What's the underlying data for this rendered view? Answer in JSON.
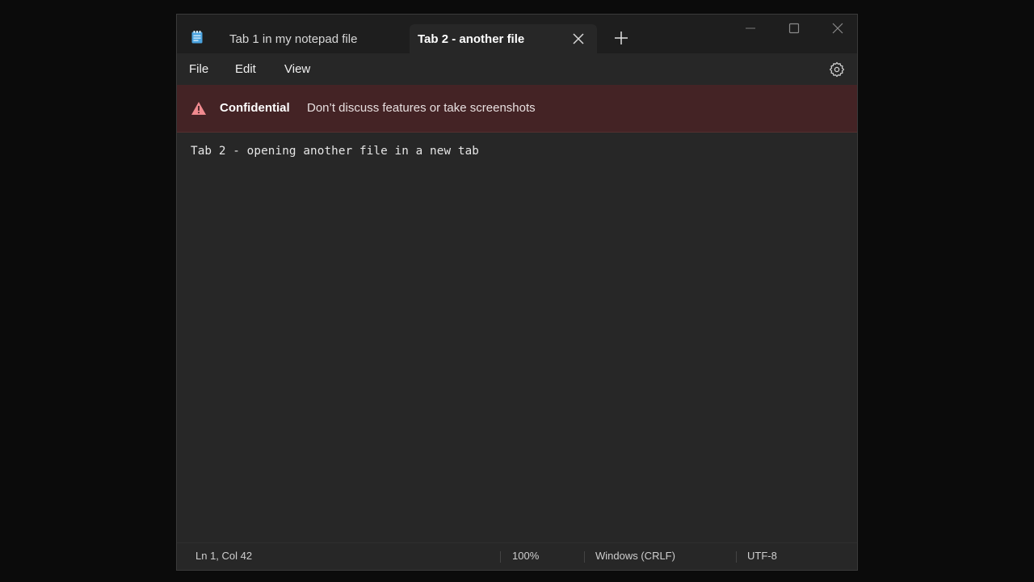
{
  "app": {
    "tabs": [
      {
        "label": "Tab 1 in my notepad file",
        "active": false
      },
      {
        "label": "Tab 2 - another file",
        "active": true
      }
    ]
  },
  "menu": {
    "file": "File",
    "edit": "Edit",
    "view": "View"
  },
  "banner": {
    "title": "Confidential",
    "text": "Don’t discuss features or take screenshots",
    "color": "#442325"
  },
  "editor": {
    "content": "Tab 2 - opening another file in a new tab"
  },
  "status": {
    "position": "Ln 1, Col 42",
    "zoom": "100%",
    "line_ending": "Windows (CRLF)",
    "encoding": "UTF-8"
  },
  "icons": {
    "app": "notepad-icon",
    "tab_close": "close-icon",
    "new_tab": "plus-icon",
    "settings": "gear-icon",
    "warning": "warning-icon",
    "minimize": "minimize-icon",
    "maximize": "maximize-icon",
    "close": "close-window-icon"
  }
}
